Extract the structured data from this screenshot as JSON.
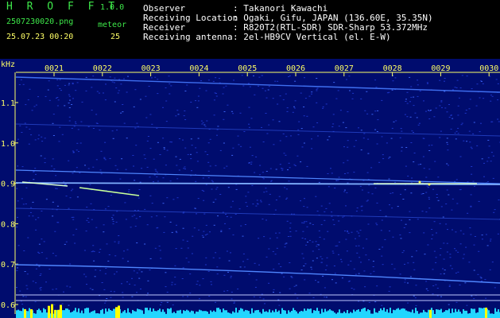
{
  "header": {
    "app_name": "H R O F F T",
    "version": "1.0.0",
    "filename": "2507230020.png",
    "datetime": "25.07.23 00:20",
    "meteor_label": "meteor",
    "meteor_count": "25",
    "info_labels": [
      "Observer",
      "Receiving Location",
      "Receiver",
      "Receiving antenna"
    ],
    "info_values": [
      ": Takanori Kawachi",
      ": Ogaki, Gifu, JAPAN (136.60E, 35.35N)",
      ": R820T2(RTL-SDR) SDR-Sharp 53.372MHz",
      ": 2el-HB9CV Vertical (el. E-W)"
    ]
  },
  "spectrogram": {
    "y_unit": "kHz",
    "y_ticks": [
      "1.1",
      "1.0",
      "0.9",
      "0.8",
      "0.7",
      "0.6"
    ],
    "x_ticks": [
      "0021",
      "0022",
      "0023",
      "0024",
      "0025",
      "0026",
      "0027",
      "0028",
      "0029",
      "0030"
    ],
    "colors": {
      "background": "#000c6e",
      "noise": "#1d36c8",
      "trace": "#4f86ff",
      "meteor": "#d8ffd0",
      "activity": "#22d6ff",
      "spike": "#ffff00"
    }
  }
}
